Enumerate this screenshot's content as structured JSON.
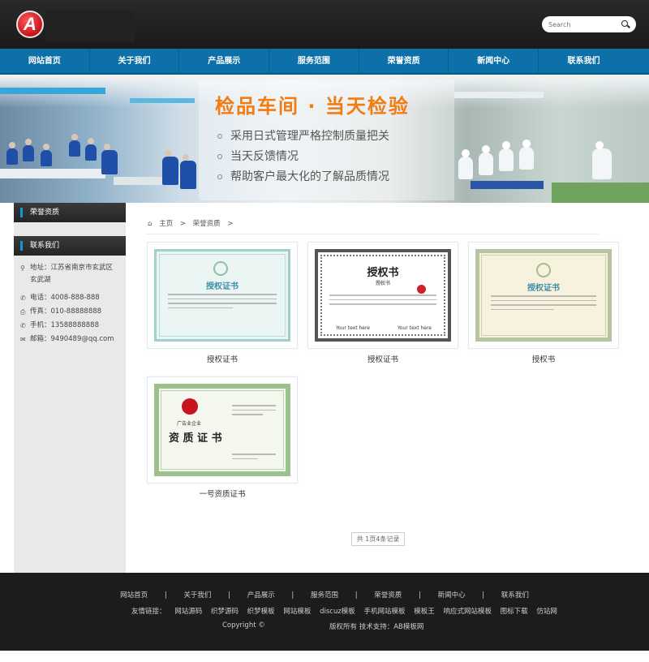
{
  "header": {
    "logo_letter": "A",
    "search_placeholder": "Search"
  },
  "nav": {
    "items": [
      "网站首页",
      "关于我们",
      "产品展示",
      "服务范围",
      "荣誉资质",
      "新闻中心",
      "联系我们"
    ]
  },
  "banner": {
    "title": "检品车间 · 当天检验",
    "lines": [
      "采用日式管理严格控制质量把关",
      "当天反馈情况",
      "帮助客户最大化的了解品质情况"
    ]
  },
  "sidebar": {
    "section1": "荣誉资质",
    "section2": "联系我们",
    "contact": {
      "address": "地址：江苏省南京市玄武区玄武湖",
      "phone": "电话：4008-888-888",
      "fax": "传真：010-88888888",
      "mobile": "手机：13588888888",
      "email": "邮箱：9490489@qq.com"
    }
  },
  "breadcrumb": {
    "home": "主页",
    "sep": ">",
    "current": "荣誉资质"
  },
  "certificates": [
    {
      "label": "授权证书",
      "heading": "授权证书"
    },
    {
      "label": "授权证书",
      "heading": "授权书",
      "sub": "授权书",
      "sign1": "Your text here",
      "sign2": "Your text here"
    },
    {
      "label": "授权书",
      "heading": "授权证书"
    },
    {
      "label": "一号资质证书",
      "heading": "资 质 证 书",
      "tag": "广告业企业"
    }
  ],
  "pager": "共 1页4条记录",
  "footer": {
    "nav": [
      "网站首页",
      "|",
      "关于我们",
      "|",
      "产品展示",
      "|",
      "服务范围",
      "|",
      "荣誉资质",
      "|",
      "新闻中心",
      "|",
      "联系我们"
    ],
    "friends_label": "友情链接：",
    "friends": [
      "网站源码",
      "织梦源码",
      "织梦模板",
      "网站模板",
      "discuz模板",
      "手机网站模板",
      "模板王",
      "响应式网站模板",
      "图标下载",
      "仿站网"
    ],
    "copyright": "Copyright ©",
    "rights": "版权所有 技术支持：AB模板网"
  },
  "colors": {
    "nav_blue": "#0d70a8",
    "accent_orange": "#f07c12",
    "sidebar_accent": "#0d9ad6"
  }
}
